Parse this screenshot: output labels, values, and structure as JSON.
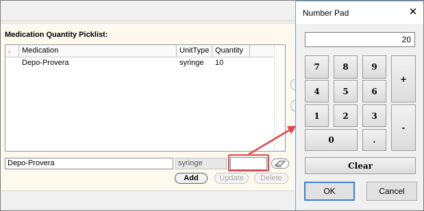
{
  "picklist": {
    "title": "Medication Quantity Picklist:",
    "columns": [
      ".",
      "Medication",
      "UnitType",
      "Quantity"
    ],
    "rows": [
      {
        "sel": "",
        "medication": "Depo-Provera",
        "unit": "syringe",
        "quantity": "10"
      }
    ]
  },
  "entry": {
    "medication": "Depo-Provera",
    "unit": "syringe",
    "quantity": ""
  },
  "buttons": {
    "add": "Add",
    "update": "Update",
    "delete": "Delete"
  },
  "numpad": {
    "title": "Number Pad",
    "display": "20",
    "keys": [
      "7",
      "8",
      "9",
      "4",
      "5",
      "6",
      "1",
      "2",
      "3",
      "0",
      "."
    ],
    "plus": "+",
    "minus": "-",
    "clear": "Clear",
    "ok": "OK",
    "cancel": "Cancel",
    "close_glyph": "✕"
  },
  "colors": {
    "annotation": "#e0474c",
    "panel_bg": "#fdf9ee",
    "dialog_border": "#6e9fd2",
    "ok_focus": "#3c7fd4"
  }
}
